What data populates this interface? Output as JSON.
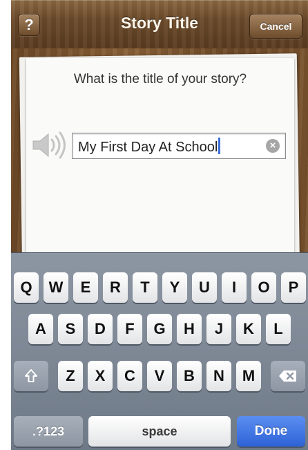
{
  "navbar": {
    "help_label": "?",
    "title": "Story Title",
    "cancel_label": "Cancel"
  },
  "prompt": {
    "question": "What is the title of your story?"
  },
  "title_field": {
    "value": "My First Day At School",
    "clear_icon": "clear-circle-x-icon"
  },
  "speaker_icon": "speaker-icon",
  "keyboard": {
    "row1": [
      "Q",
      "W",
      "E",
      "R",
      "T",
      "Y",
      "U",
      "I",
      "O",
      "P"
    ],
    "row2": [
      "A",
      "S",
      "D",
      "F",
      "G",
      "H",
      "J",
      "K",
      "L"
    ],
    "row3": [
      "Z",
      "X",
      "C",
      "V",
      "B",
      "N",
      "M"
    ],
    "shift_icon": "shift-arrow-icon",
    "backspace_icon": "backspace-icon",
    "num_label": ".?123",
    "space_label": "space",
    "done_label": "Done"
  },
  "colors": {
    "nav_wood": "#6b4a2a",
    "done_blue": "#2e63d6",
    "keyboard_bg": "#7e8895"
  }
}
